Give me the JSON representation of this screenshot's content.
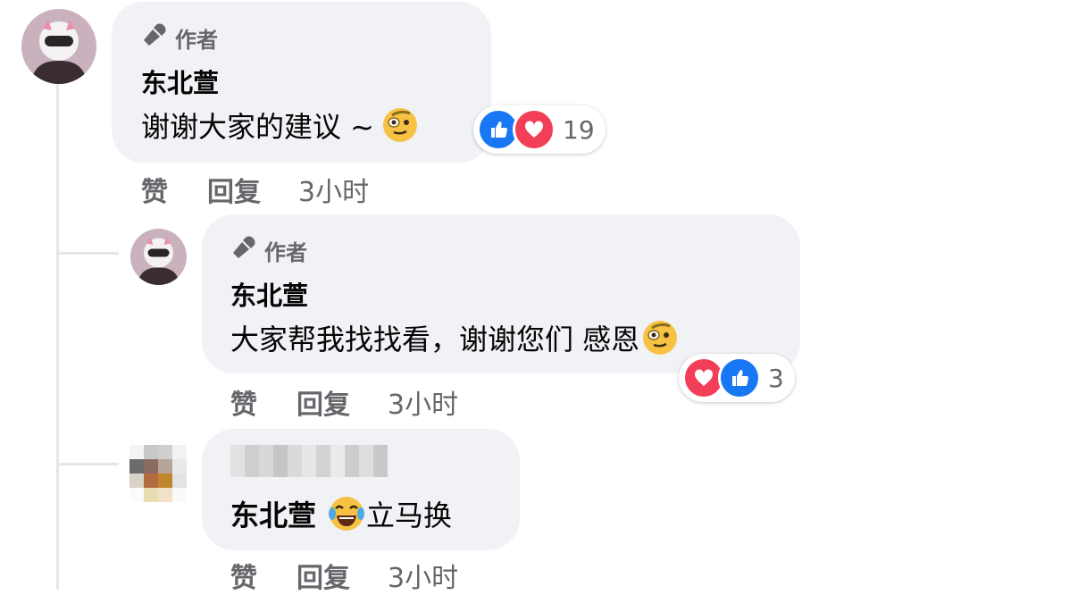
{
  "comments": [
    {
      "author_badge": "作者",
      "name": "东北萱",
      "text": "谢谢大家的建议 ~",
      "emoji": "thinking-monocle-emoji",
      "reactions": {
        "icons": [
          "like",
          "love"
        ],
        "count": "19"
      },
      "actions": {
        "like": "赞",
        "reply": "回复",
        "time": "3小时"
      }
    },
    {
      "author_badge": "作者",
      "name": "东北萱",
      "text": "大家帮我找找看，谢谢您们 感恩",
      "emoji": "thinking-monocle-emoji",
      "reactions": {
        "icons": [
          "love",
          "like"
        ],
        "count": "3"
      },
      "actions": {
        "like": "赞",
        "reply": "回复",
        "time": "3小时"
      }
    },
    {
      "name_blurred": true,
      "mention": "东北萱",
      "emoji": "tears-of-joy-emoji",
      "text": "立马换",
      "actions": {
        "like": "赞",
        "reply": "回复",
        "time": "3小时"
      }
    }
  ],
  "colors": {
    "bubble": "#f0f2f5",
    "like": "#1877f2",
    "love": "#f33e58",
    "muted": "#65676b"
  }
}
